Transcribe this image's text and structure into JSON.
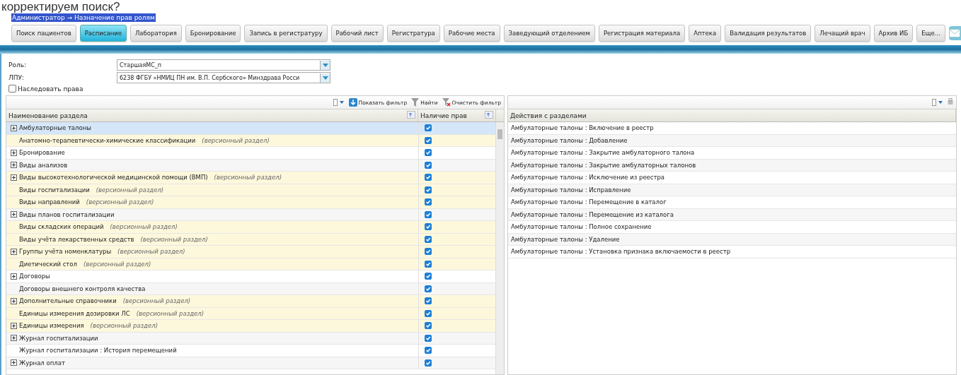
{
  "page_heading": "корректируем поиск?",
  "breadcrumb": "Администратор → Назначение прав ролям",
  "nav_buttons": [
    {
      "label": "Поиск пациентов",
      "selected": false
    },
    {
      "label": "Расписание",
      "selected": true
    },
    {
      "label": "Лаборатория",
      "selected": false
    },
    {
      "label": "Бронирование",
      "selected": false
    },
    {
      "label": "Запись в регистратуру",
      "selected": false
    },
    {
      "label": "Рабочий лист",
      "selected": false
    },
    {
      "label": "Регистратура",
      "selected": false
    },
    {
      "label": "Рабочие места",
      "selected": false
    },
    {
      "label": "Заведующий отделением",
      "selected": false
    },
    {
      "label": "Регистрация материала",
      "selected": false
    },
    {
      "label": "Аптека",
      "selected": false
    },
    {
      "label": "Валидация результатов",
      "selected": false
    },
    {
      "label": "Лечащий врач",
      "selected": false
    },
    {
      "label": "Архив ИБ",
      "selected": false
    },
    {
      "label": "Еще...",
      "selected": false
    }
  ],
  "form": {
    "role_label": "Роль:",
    "role_value": "СтаршаяМС_п",
    "lpu_label": "ЛПУ:",
    "lpu_value": "6238 ФГБУ «НМИЦ ПН им. В.П. Сербского» Минздрава Росси",
    "inherit": {
      "label": "Наследовать права",
      "checked": false
    }
  },
  "left_grid": {
    "toolbar": [
      "Показать фильтр",
      "Найти",
      "Очистить фильтр"
    ],
    "columns": [
      "Наименование раздела",
      "Наличие прав"
    ],
    "rows": [
      {
        "name": "Амбулаторные талоны",
        "expandable": true,
        "versioned": false,
        "checked": true,
        "selected": true
      },
      {
        "name": "Анатомно-терапевтически-химические классификации",
        "note": "(версионный раздел)",
        "expandable": false,
        "versioned": true,
        "checked": true,
        "selected": false
      },
      {
        "name": "Бронирование",
        "expandable": true,
        "versioned": false,
        "checked": true,
        "selected": false
      },
      {
        "name": "Виды анализов",
        "expandable": true,
        "versioned": false,
        "checked": true,
        "selected": false
      },
      {
        "name": "Виды высокотехнологической медицинской помощи (ВМП)",
        "note": "(версионный раздел)",
        "expandable": true,
        "versioned": true,
        "checked": true,
        "selected": false
      },
      {
        "name": "Виды госпитализации",
        "note": "(версионный раздел)",
        "expandable": false,
        "versioned": true,
        "checked": true,
        "selected": false
      },
      {
        "name": "Виды направлений",
        "note": "(версионный раздел)",
        "expandable": false,
        "versioned": true,
        "checked": true,
        "selected": false
      },
      {
        "name": "Виды планов госпитализации",
        "expandable": true,
        "versioned": false,
        "checked": true,
        "selected": false
      },
      {
        "name": "Виды складских операций",
        "note": "(версионный раздел)",
        "expandable": false,
        "versioned": true,
        "checked": true,
        "selected": false
      },
      {
        "name": "Виды учёта лекарственных средств",
        "note": "(версионный раздел)",
        "expandable": false,
        "versioned": true,
        "checked": true,
        "selected": false
      },
      {
        "name": "Группы учёта номенклатуры",
        "note": "(версионный раздел)",
        "expandable": true,
        "versioned": true,
        "checked": true,
        "selected": false
      },
      {
        "name": "Диетический стол",
        "note": "(версионный раздел)",
        "expandable": false,
        "versioned": true,
        "checked": true,
        "selected": false
      },
      {
        "name": "Договоры",
        "expandable": true,
        "versioned": false,
        "checked": true,
        "selected": false
      },
      {
        "name": "Договоры внешнего контроля качества",
        "expandable": false,
        "versioned": false,
        "checked": true,
        "selected": false
      },
      {
        "name": "Дополнительные справочники",
        "note": "(версионный раздел)",
        "expandable": true,
        "versioned": true,
        "checked": true,
        "selected": false
      },
      {
        "name": "Единицы измерения дозировки ЛС",
        "note": "(версионный раздел)",
        "expandable": false,
        "versioned": true,
        "checked": true,
        "selected": false
      },
      {
        "name": "Единицы измерения",
        "note": "(версионный раздел)",
        "expandable": true,
        "versioned": true,
        "checked": true,
        "selected": false
      },
      {
        "name": "Журнал госпитализации",
        "expandable": true,
        "versioned": false,
        "checked": true,
        "selected": false
      },
      {
        "name": "Журнал госпитализации : История перемещений",
        "expandable": false,
        "versioned": false,
        "checked": true,
        "selected": false
      },
      {
        "name": "Журнал оплат",
        "expandable": true,
        "versioned": false,
        "checked": true,
        "selected": false
      }
    ]
  },
  "right_grid": {
    "column": "Действия с разделами",
    "rows": [
      "Амбулаторные талоны : Включение в реестр",
      "Амбулаторные талоны : Добавление",
      "Амбулаторные талоны : Закрытие амбулаторного талона",
      "Амбулаторные талоны : Закрытие амбулаторных талонов",
      "Амбулаторные талоны : Исключение из реестра",
      "Амбулаторные талоны : Исправление",
      "Амбулаторные талоны : Перемещение в каталог",
      "Амбулаторные талоны : Перемещение из каталога",
      "Амбулаторные талоны : Полное сохранение",
      "Амбулаторные талоны : Удаление",
      "Амбулаторные талоны : Установка признака включаемости в реестр"
    ]
  }
}
